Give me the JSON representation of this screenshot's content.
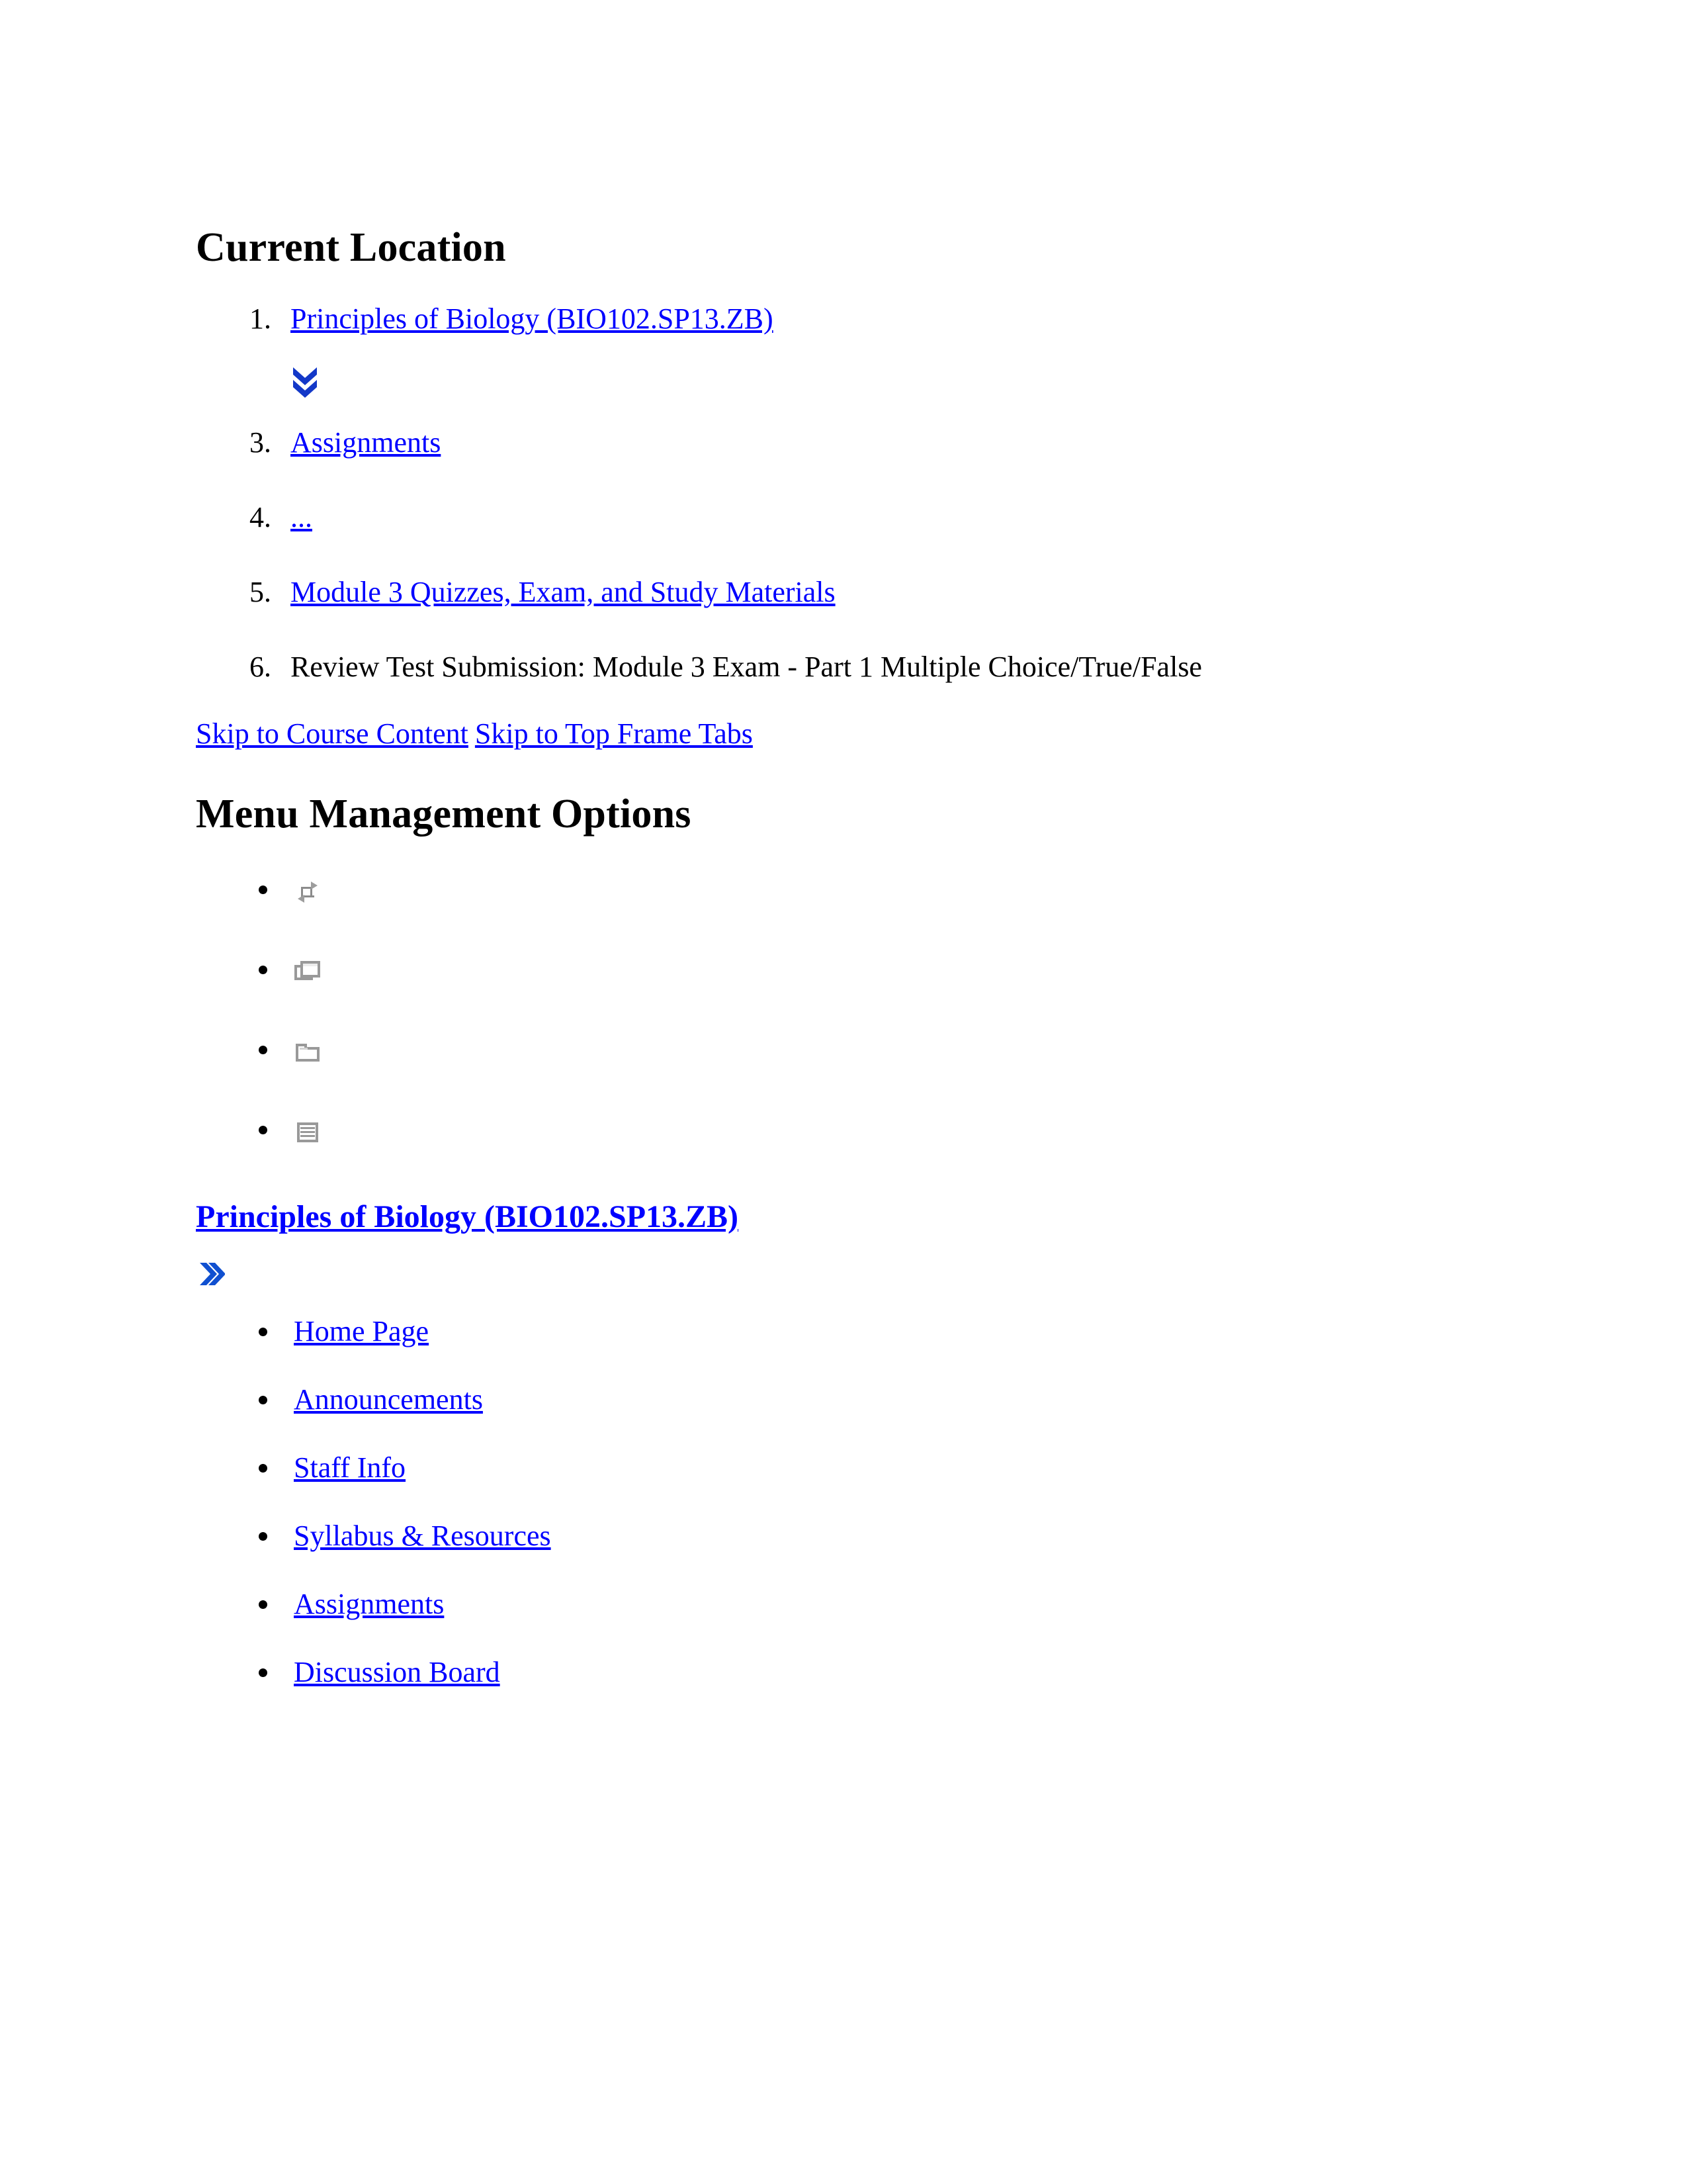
{
  "colors": {
    "link": "#0000ff",
    "chevron": "#1338c8",
    "icon_gray": "#999999",
    "text": "#000000"
  },
  "current_location": {
    "heading": "Current Location",
    "items": [
      {
        "label": "Principles of Biology (BIO102.SP13.ZB)",
        "is_link": true
      },
      {
        "label": "Assignments",
        "is_link": true
      },
      {
        "label": "...",
        "is_link": true
      },
      {
        "label": "Module 3 Quizzes, Exam, and Study Materials",
        "is_link": true
      },
      {
        "label": "Review Test Submission: Module 3 Exam - Part 1 Multiple Choice/True/False",
        "is_link": false
      }
    ],
    "expand_icon": "chevron-double-down-icon"
  },
  "skip_links": {
    "course_content": "Skip to Course Content",
    "top_frame_tabs": "Skip to Top Frame Tabs"
  },
  "menu_management": {
    "heading": "Menu Management Options",
    "options": [
      {
        "icon": "refresh-icon"
      },
      {
        "icon": "open-in-new-window-icon"
      },
      {
        "icon": "folder-icon"
      },
      {
        "icon": "list-view-icon"
      }
    ]
  },
  "course_nav": {
    "title": "Principles of Biology (BIO102.SP13.ZB)",
    "collapse_icon": "chevron-double-right-icon",
    "items": [
      {
        "label": "Home Page"
      },
      {
        "label": "Announcements"
      },
      {
        "label": "Staff Info"
      },
      {
        "label": "Syllabus & Resources"
      },
      {
        "label": "Assignments"
      },
      {
        "label": "Discussion Board"
      }
    ]
  }
}
